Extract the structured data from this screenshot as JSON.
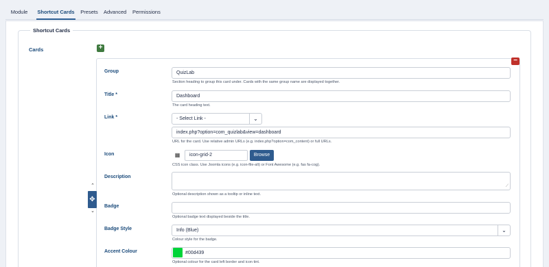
{
  "tabs": [
    {
      "label": "Module"
    },
    {
      "label": "Shortcut Cards"
    },
    {
      "label": "Presets"
    },
    {
      "label": "Advanced"
    },
    {
      "label": "Permissions"
    }
  ],
  "fieldset": {
    "legend": "Shortcut Cards",
    "cards_label": "Cards"
  },
  "controls": {
    "add": "+",
    "remove": "−",
    "up": "⌃",
    "down": "⌄",
    "move": "✥"
  },
  "fields": {
    "group": {
      "label": "Group",
      "value": "QuizLab",
      "hint": "Section heading to group this card under. Cards with the same group name are displayed together."
    },
    "title": {
      "label": "Title *",
      "value": "Dashboard",
      "hint": "The card heading text."
    },
    "link": {
      "label": "Link *",
      "select": "- Select Link -",
      "value": "index.php?option=com_quizlab&view=dashboard",
      "hint": "URL for the card. Use relative admin URLs (e.g. index.php?option=com_content) or full URLs."
    },
    "icon": {
      "label": "Icon",
      "value": "icon-grid-2",
      "browse": "Browse",
      "hint": "CSS icon class. Use Joomla icons (e.g. icon-file-alt) or Font Awesome (e.g. fas fa-cog).",
      "prefix_icon": "grid-icon"
    },
    "description": {
      "label": "Description",
      "value": "",
      "hint": "Optional description shown as a tooltip or inline text."
    },
    "badge": {
      "label": "Badge",
      "value": "",
      "hint": "Optional badge text displayed beside the title."
    },
    "badge_style": {
      "label": "Badge Style",
      "value": "Info (Blue)",
      "hint": "Colour style for the badge."
    },
    "accent": {
      "label": "Accent Colour",
      "value": "#00d439",
      "color": "#00d439",
      "hint": "Optional colour for the card left border and icon tint."
    }
  },
  "colors": {
    "accent_primary": "#2f5b8e",
    "add": "#3f7a3f",
    "remove": "#c0312b"
  }
}
